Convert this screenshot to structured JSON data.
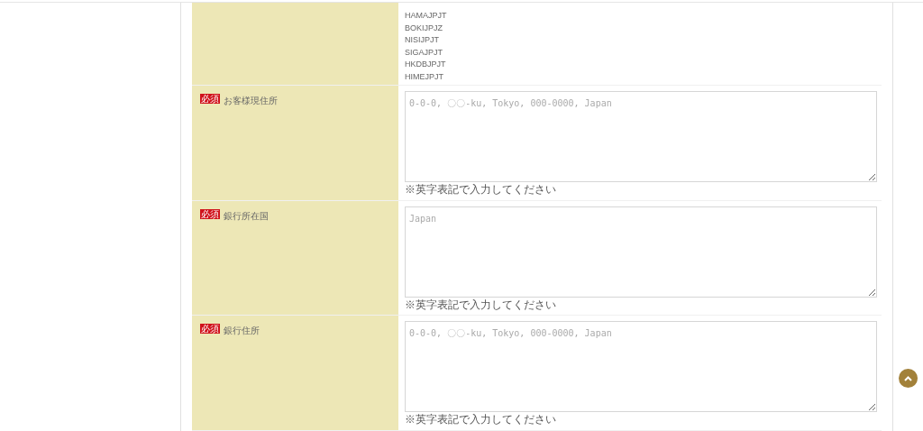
{
  "top_row": {
    "codes": [
      "HAMAJPJT",
      "BOKIJPJZ",
      "NISIJPJT",
      "SIGAJPJT",
      "HKDBJPJT",
      "HIMEJPJT"
    ]
  },
  "fields": [
    {
      "required_badge": "必須",
      "label": "お客様現住所",
      "placeholder": "0-0-0, 〇〇-ku, Tokyo, 000-0000, Japan",
      "note": "※英字表記で入力してください"
    },
    {
      "required_badge": "必須",
      "label": "銀行所在国",
      "placeholder": "Japan",
      "note": "※英字表記で入力してください"
    },
    {
      "required_badge": "必須",
      "label": "銀行住所",
      "placeholder": "0-0-0, 〇〇-ku, Tokyo, 000-0000, Japan",
      "note": "※英字表記で入力してください"
    }
  ]
}
